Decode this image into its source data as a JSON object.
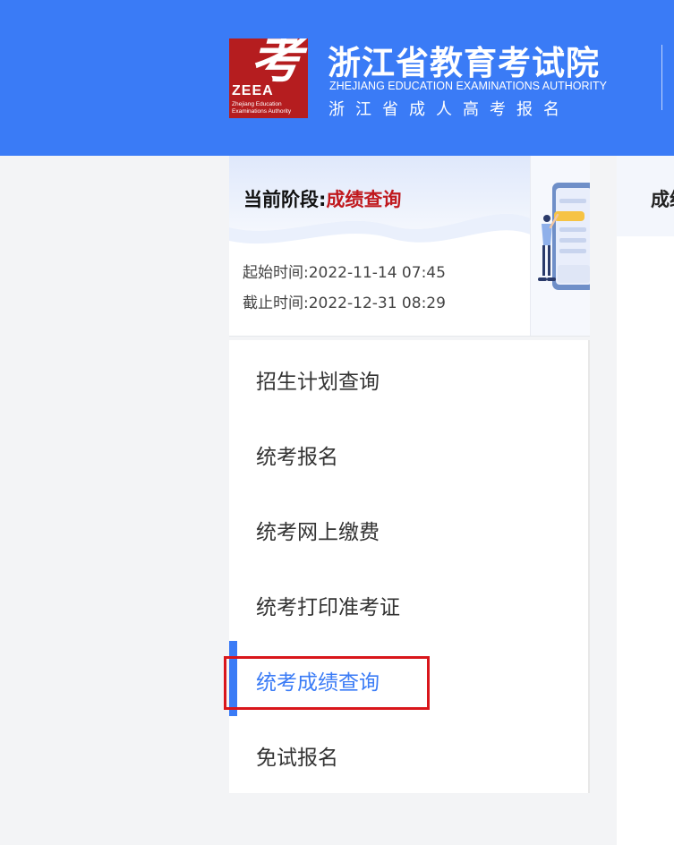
{
  "header": {
    "logo": {
      "char": "考",
      "abbr": "ZEEA",
      "sub_line1": "Zhejiang Education",
      "sub_line2": "Examinations Authority"
    },
    "org_name_cn": "浙江省教育考试院",
    "org_name_en": "ZHEJIANG EDUCATION EXAMINATIONS AUTHORITY",
    "subtitle": "浙江省成人高考报名",
    "brand_color": "#3a7bf6"
  },
  "stage": {
    "label": "当前阶段:",
    "value": "成绩查询",
    "start_label": "起始时间:",
    "start_value": "2022-11-14 07:45",
    "end_label": "截止时间:",
    "end_value": "2022-12-31 08:29"
  },
  "right_panel": {
    "title": "成绩"
  },
  "menu": {
    "items": [
      {
        "label": "招生计划查询",
        "active": false
      },
      {
        "label": "统考报名",
        "active": false
      },
      {
        "label": "统考网上缴费",
        "active": false
      },
      {
        "label": "统考打印准考证",
        "active": false
      },
      {
        "label": "统考成绩查询",
        "active": true
      },
      {
        "label": "免试报名",
        "active": false
      }
    ]
  },
  "colors": {
    "active": "#3a7bf6",
    "stage_value": "#c0191e",
    "highlight": "#d9161b"
  }
}
